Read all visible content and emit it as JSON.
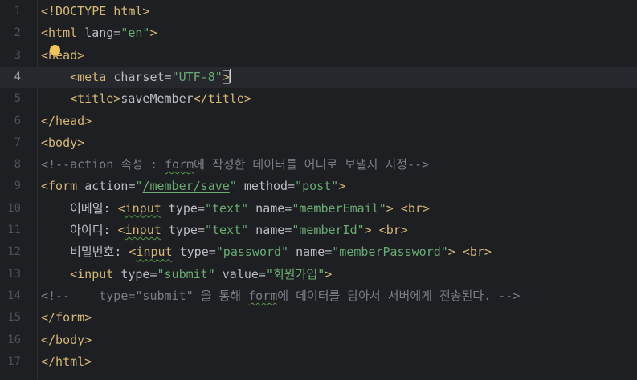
{
  "editor": {
    "lines": [
      {
        "num": "1",
        "segs": [
          [
            "t",
            "<!DOCTYPE html>"
          ]
        ]
      },
      {
        "num": "2",
        "segs": [
          [
            "t",
            "<html "
          ],
          [
            "a",
            "lang="
          ],
          [
            "v",
            "\"en\""
          ],
          [
            "t",
            ">"
          ]
        ]
      },
      {
        "num": "3",
        "segs": [
          [
            "t",
            "<head>"
          ]
        ]
      },
      {
        "num": "4",
        "current": true,
        "segs": [
          [
            "p",
            "    "
          ],
          [
            "t",
            "<meta "
          ],
          [
            "a",
            "charset="
          ],
          [
            "v",
            "\"UTF-8\""
          ],
          [
            "tm",
            ">"
          ],
          [
            "caret",
            ""
          ]
        ]
      },
      {
        "num": "5",
        "segs": [
          [
            "p",
            "    "
          ],
          [
            "t",
            "<title>"
          ],
          [
            "p",
            "saveMember"
          ],
          [
            "t",
            "</title>"
          ]
        ]
      },
      {
        "num": "6",
        "segs": [
          [
            "t",
            "</head>"
          ]
        ]
      },
      {
        "num": "7",
        "segs": [
          [
            "t",
            "<body>"
          ]
        ]
      },
      {
        "num": "8",
        "segs": [
          [
            "c",
            "<!--action 속성 : "
          ],
          [
            "cu",
            "form"
          ],
          [
            "c",
            "에 작성한 데이터를 어디로 보낼지 지정-->"
          ]
        ]
      },
      {
        "num": "9",
        "segs": [
          [
            "t",
            "<form "
          ],
          [
            "a",
            "action="
          ],
          [
            "v",
            "\""
          ],
          [
            "vl",
            "/member/save"
          ],
          [
            "v",
            "\""
          ],
          [
            "a",
            " method="
          ],
          [
            "v",
            "\"post\""
          ],
          [
            "t",
            ">"
          ]
        ]
      },
      {
        "num": "10",
        "segs": [
          [
            "p",
            "    이메일: "
          ],
          [
            "t",
            "<"
          ],
          [
            "tu",
            "input"
          ],
          [
            "a",
            " type="
          ],
          [
            "v",
            "\"text\""
          ],
          [
            "a",
            " name="
          ],
          [
            "v",
            "\"memberEmail\""
          ],
          [
            "t",
            "> <br>"
          ]
        ]
      },
      {
        "num": "11",
        "segs": [
          [
            "p",
            "    아이디: "
          ],
          [
            "t",
            "<"
          ],
          [
            "tu",
            "input"
          ],
          [
            "a",
            " type="
          ],
          [
            "v",
            "\"text\""
          ],
          [
            "a",
            " name="
          ],
          [
            "v",
            "\"memberId\""
          ],
          [
            "t",
            "> <br>"
          ]
        ]
      },
      {
        "num": "12",
        "segs": [
          [
            "p",
            "    비밀번호: "
          ],
          [
            "t",
            "<"
          ],
          [
            "tu",
            "input"
          ],
          [
            "a",
            " type="
          ],
          [
            "v",
            "\"password\""
          ],
          [
            "a",
            " name="
          ],
          [
            "v",
            "\"memberPassword\""
          ],
          [
            "t",
            "> <br>"
          ]
        ]
      },
      {
        "num": "13",
        "segs": [
          [
            "p",
            "    "
          ],
          [
            "t",
            "<input "
          ],
          [
            "a",
            "type="
          ],
          [
            "v",
            "\"submit\""
          ],
          [
            "a",
            " value="
          ],
          [
            "v",
            "\"회원가입\""
          ],
          [
            "t",
            ">"
          ]
        ]
      },
      {
        "num": "14",
        "segs": [
          [
            "c",
            "<!--    type=\"submit\" 을 통해 "
          ],
          [
            "cu",
            "form"
          ],
          [
            "c",
            "에 데이터를 담아서 서버에게 전송된다. -->"
          ]
        ]
      },
      {
        "num": "15",
        "segs": [
          [
            "t",
            "</form>"
          ]
        ]
      },
      {
        "num": "16",
        "segs": [
          [
            "t",
            "</body>"
          ]
        ]
      },
      {
        "num": "17",
        "segs": [
          [
            "t",
            "</html>"
          ]
        ]
      }
    ],
    "colors": {
      "background": "#1e1f22",
      "tag": "#d5b778",
      "attribute": "#bcbec4",
      "value": "#6aab73",
      "comment": "#7a7e85",
      "line_number": "#4b5059"
    },
    "icons": {
      "intention": "lightbulb-icon"
    }
  }
}
